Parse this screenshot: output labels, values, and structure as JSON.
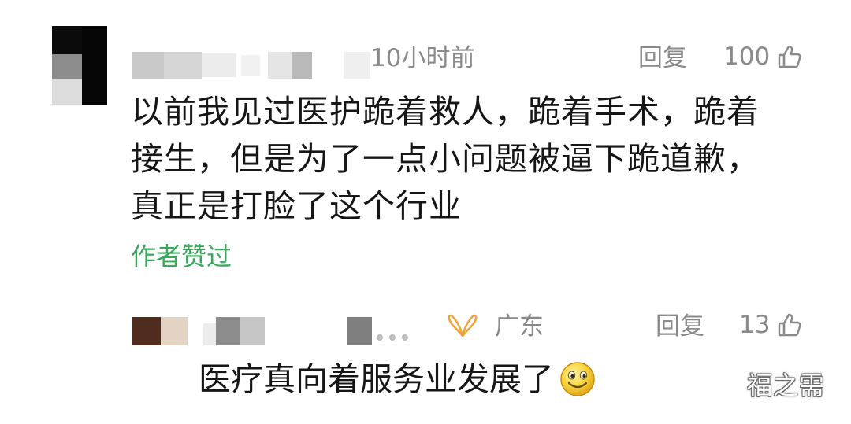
{
  "comments": [
    {
      "time": "10小时前",
      "reply_label": "回复",
      "like_count": "100",
      "lines": [
        "以前我见过医护跪着救人，跪着手术，跪着",
        "接生，但是为了一点小问题被逼下跪道歉，",
        "真正是打脸了这个行业"
      ],
      "author_badge": "作者赞过",
      "avatar_pixelated": true,
      "username_pixelated": true
    },
    {
      "region": "广东",
      "reply_label": "回复",
      "like_count": "13",
      "text": "医疗真向着服务业发展了",
      "emoji": "smile-emoji",
      "avatar_pixelated": true,
      "username_pixelated": true
    }
  ],
  "watermark": "福之需",
  "colors": {
    "meta_gray": "#8a8a8a",
    "author_badge_green": "#3aa85b",
    "text": "#161616",
    "location_icon": "#f0a53c",
    "emoji_face": "#f7d33c"
  },
  "icons": {
    "like": "thumbs-up-outline-icon",
    "location": "ip-location-icon",
    "emoji": "smile-emoji-icon"
  }
}
